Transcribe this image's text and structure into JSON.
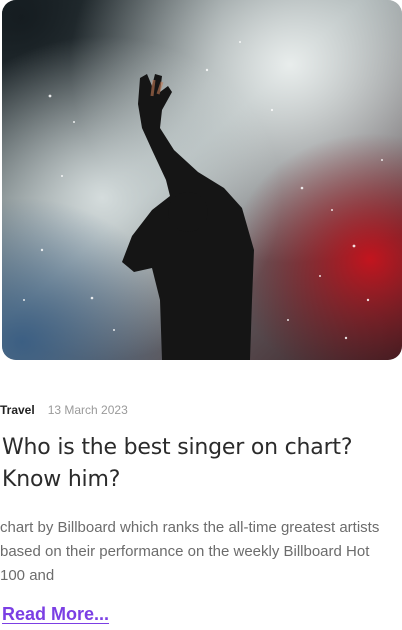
{
  "post": {
    "image_alt": "Singer with raised hand holding a microphone on a smoky stage",
    "category": "Travel",
    "date": "13 March 2023",
    "title": "Who is the best singer on chart? Know him?",
    "excerpt": "chart by Billboard which ranks the all-time greatest artists based on their performance on the weekly Billboard Hot 100 and",
    "read_more": "Read More..."
  },
  "colors": {
    "accent": "#7b3fe4",
    "title": "#2b2b2b",
    "body_text": "#6c6c6c",
    "date": "#9a9a9a"
  }
}
